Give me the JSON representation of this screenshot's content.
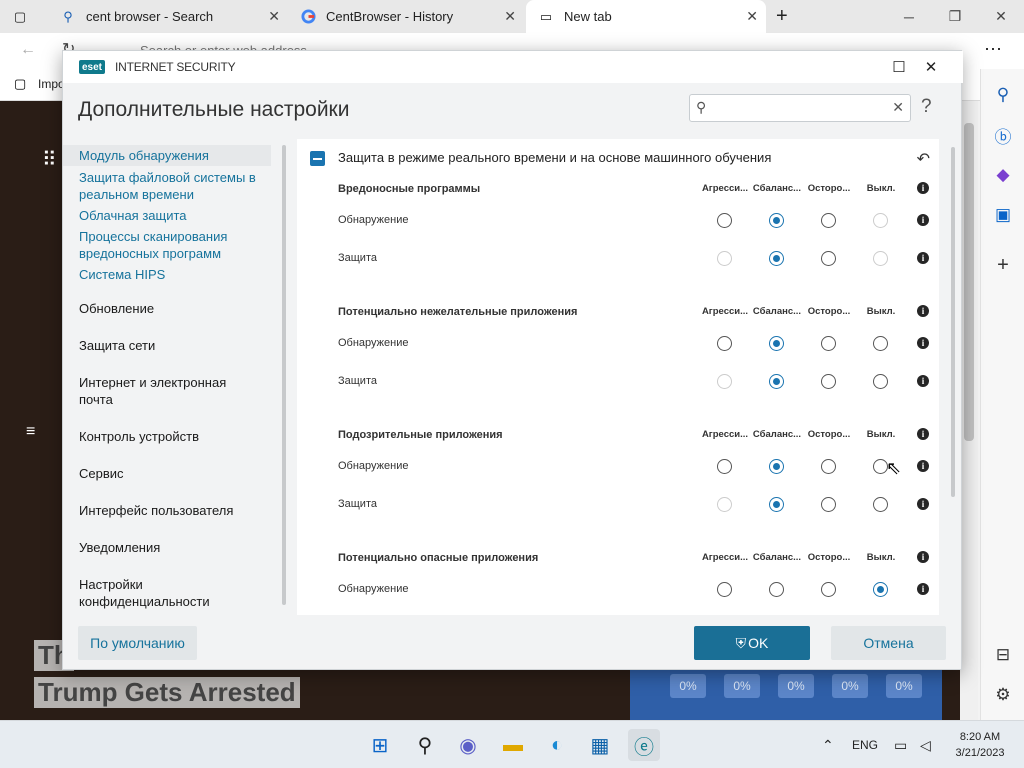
{
  "browser": {
    "tabs": [
      {
        "title": "cent browser - Search",
        "icon": "search-icon"
      },
      {
        "title": "CentBrowser - History",
        "icon": "google-icon"
      },
      {
        "title": "New tab",
        "icon": "newtab-icon"
      }
    ],
    "address_placeholder": "Search or enter web address",
    "favorites_item": "Impo",
    "headline_line1": "Th",
    "headline_line2": "Trump Gets Arrested",
    "weather_values": [
      "0%",
      "0%",
      "0%",
      "0%",
      "0%"
    ]
  },
  "dialog": {
    "product_logo": "eset",
    "product_name": "INTERNET SECURITY",
    "title": "Дополнительные настройки",
    "search_value": "",
    "help_symbol": "?",
    "nav": [
      {
        "label": "Модуль обнаружения",
        "type": "link",
        "selected": true
      },
      {
        "label": "Защита файловой системы в реальном времени",
        "type": "link"
      },
      {
        "label": "Облачная защита",
        "type": "link"
      },
      {
        "label": "Процессы сканирования вредоносных программ",
        "type": "link"
      },
      {
        "label": "Система HIPS",
        "type": "link"
      },
      {
        "label": "Обновление",
        "type": "section"
      },
      {
        "label": "Защита сети",
        "type": "section"
      },
      {
        "label": "Интернет и электронная почта",
        "type": "section"
      },
      {
        "label": "Контроль устройств",
        "type": "section"
      },
      {
        "label": "Сервис",
        "type": "section"
      },
      {
        "label": "Интерфейс пользователя",
        "type": "section"
      },
      {
        "label": "Уведомления",
        "type": "section"
      },
      {
        "label": "Настройки конфиденциальности",
        "type": "section"
      }
    ],
    "section_title": "Защита в режиме реального времени и на основе машинного обучения",
    "columns": [
      "Агресси...",
      "Сбаланс...",
      "Осторо...",
      "Выкл."
    ],
    "groups": [
      {
        "title": "Вредоносные программы",
        "rows": [
          {
            "label": "Обнаружение",
            "selected": 1,
            "disabled": [
              3
            ]
          },
          {
            "label": "Защита",
            "selected": 1,
            "disabled": [
              0,
              3
            ]
          }
        ]
      },
      {
        "title": "Потенциально нежелательные приложения",
        "rows": [
          {
            "label": "Обнаружение",
            "selected": 1,
            "disabled": []
          },
          {
            "label": "Защита",
            "selected": 1,
            "disabled": [
              0
            ]
          }
        ]
      },
      {
        "title": "Подозрительные приложения",
        "rows": [
          {
            "label": "Обнаружение",
            "selected": 1,
            "disabled": []
          },
          {
            "label": "Защита",
            "selected": 1,
            "disabled": [
              0
            ]
          }
        ]
      },
      {
        "title": "Потенциально опасные приложения",
        "rows": [
          {
            "label": "Обнаружение",
            "selected": 3,
            "disabled": []
          }
        ]
      }
    ],
    "buttons": {
      "default": "По умолчанию",
      "ok": "OK",
      "cancel": "Отмена"
    }
  },
  "taskbar": {
    "language": "ENG",
    "time": "8:20 AM",
    "date": "3/21/2023"
  }
}
